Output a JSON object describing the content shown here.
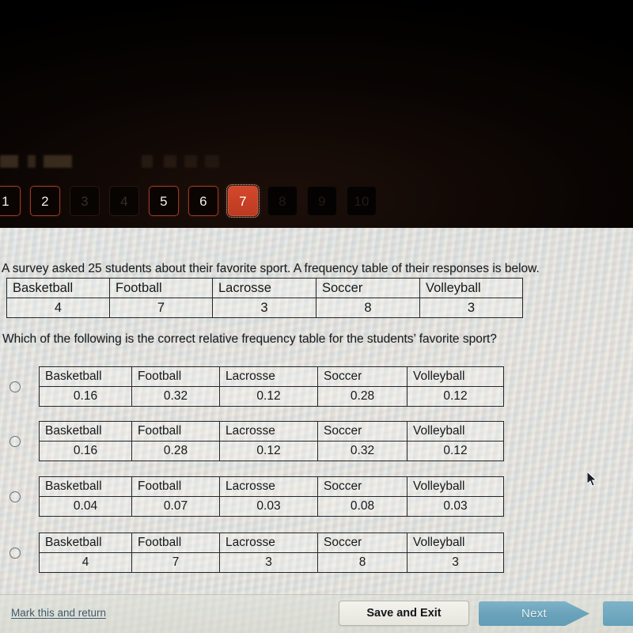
{
  "pager": {
    "items": [
      {
        "label": "1",
        "state": "outlined"
      },
      {
        "label": "2",
        "state": "outlined"
      },
      {
        "label": "3",
        "state": "dim"
      },
      {
        "label": "4",
        "state": "dim"
      },
      {
        "label": "5",
        "state": "outlined"
      },
      {
        "label": "6",
        "state": "outlined"
      },
      {
        "label": "7",
        "state": "current"
      },
      {
        "label": "8",
        "state": "ghost"
      },
      {
        "label": "9",
        "state": "ghost"
      },
      {
        "label": "10",
        "state": "ghost"
      }
    ],
    "current": "7",
    "accent_color": "#c9432a",
    "outline_color": "#9a3a25"
  },
  "question": {
    "stem_line_1": "A survey asked 25 students about their favorite sport. A frequency table of their responses is below.",
    "stem_line_2": "Which of the following is the correct relative frequency table for the students’ favorite sport?",
    "frequency_table": {
      "headers": [
        "Basketball",
        "Football",
        "Lacrosse",
        "Soccer",
        "Volleyball"
      ],
      "values": [
        "4",
        "7",
        "3",
        "8",
        "3"
      ]
    },
    "options": [
      {
        "id": "A",
        "selected": false,
        "headers": [
          "Basketball",
          "Football",
          "Lacrosse",
          "Soccer",
          "Volleyball"
        ],
        "values": [
          "0.16",
          "0.32",
          "0.12",
          "0.28",
          "0.12"
        ]
      },
      {
        "id": "B",
        "selected": false,
        "headers": [
          "Basketball",
          "Football",
          "Lacrosse",
          "Soccer",
          "Volleyball"
        ],
        "values": [
          "0.16",
          "0.28",
          "0.12",
          "0.32",
          "0.12"
        ]
      },
      {
        "id": "C",
        "selected": false,
        "headers": [
          "Basketball",
          "Football",
          "Lacrosse",
          "Soccer",
          "Volleyball"
        ],
        "values": [
          "0.04",
          "0.07",
          "0.03",
          "0.08",
          "0.03"
        ]
      },
      {
        "id": "D",
        "selected": false,
        "headers": [
          "Basketball",
          "Football",
          "Lacrosse",
          "Soccer",
          "Volleyball"
        ],
        "values": [
          "4",
          "7",
          "3",
          "8",
          "3"
        ]
      }
    ]
  },
  "footer": {
    "mark_link": "Mark this and return",
    "save_exit": "Save and Exit",
    "next": "Next",
    "link_color": "#3f5b6b",
    "next_color": "#6aa2ba"
  }
}
